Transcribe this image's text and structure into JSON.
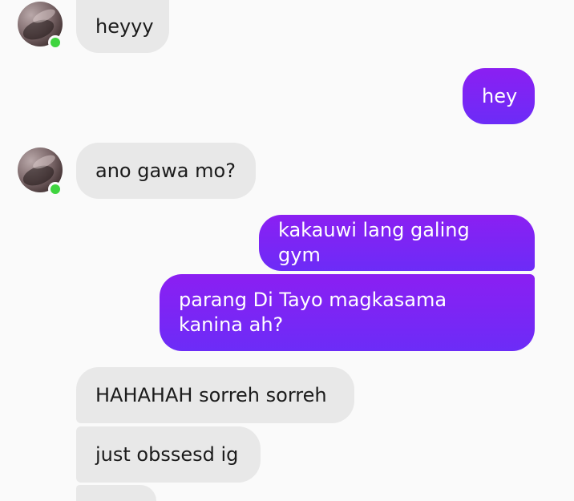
{
  "conversation": {
    "messages": [
      {
        "sender": "contact",
        "text": "heyyy"
      },
      {
        "sender": "me",
        "text": "hey"
      },
      {
        "sender": "contact",
        "text": "ano gawa mo?"
      },
      {
        "sender": "me",
        "text": "kakauwi lang galing gym"
      },
      {
        "sender": "me",
        "text": "parang Di Tayo magkasama\nkanina ah?"
      },
      {
        "sender": "contact",
        "text": "HAHAHAH sorreh sorreh"
      },
      {
        "sender": "contact",
        "text": "just obssesd ig"
      }
    ]
  },
  "contact": {
    "online": true,
    "avatar_icon": "profile-photo",
    "online_color": "#3fd43f"
  },
  "colors": {
    "incoming_bubble": "#e8e8e8",
    "outgoing_bubble_top": "#8b1ff2",
    "outgoing_bubble_bottom": "#6c2cf7",
    "background": "#fafafa"
  }
}
